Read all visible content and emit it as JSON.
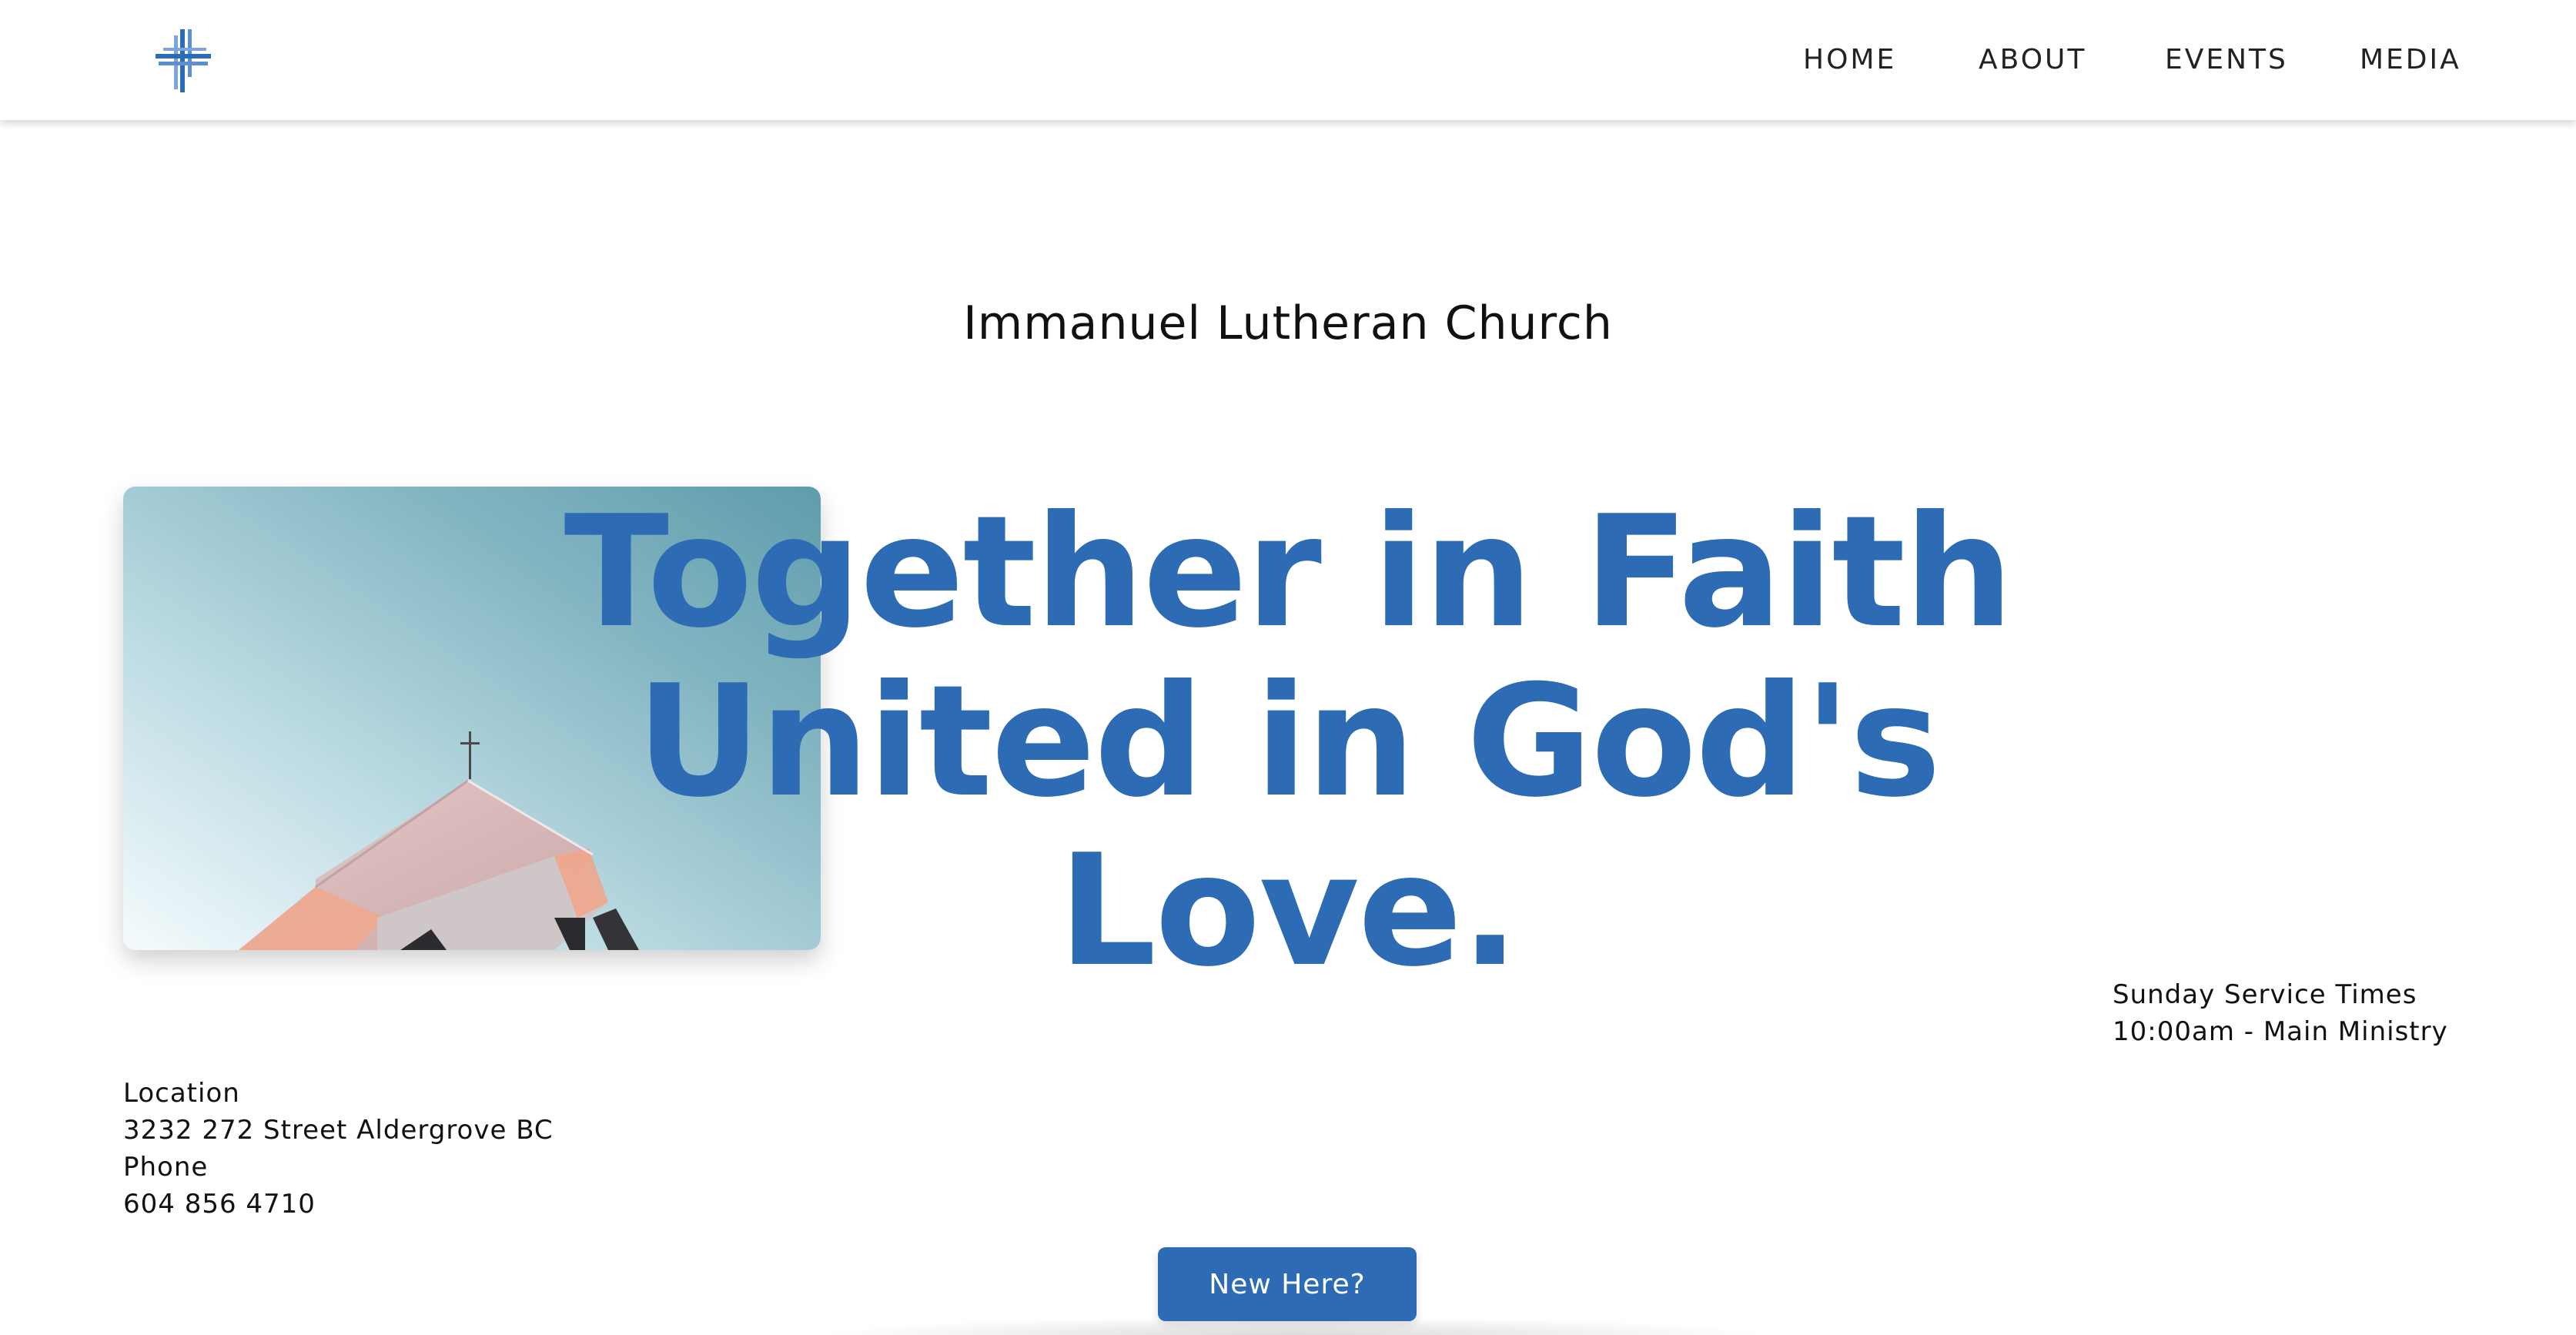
{
  "nav": {
    "logo_icon": "lutheran-cross-icon",
    "items": [
      {
        "label": "HOME"
      },
      {
        "label": "ABOUT"
      },
      {
        "label": "EVENTS"
      },
      {
        "label": "MEDIA"
      }
    ]
  },
  "hero": {
    "eyebrow": "Immanuel Lutheran Church",
    "headline_lines": [
      "Together in Faith",
      "United in God's",
      "Love."
    ],
    "image": "church-rooftop-photo",
    "cta_label": "New Here?"
  },
  "service": {
    "heading": "Sunday Service Times",
    "time": "10:00am - Main Ministry"
  },
  "contact": {
    "location_label": "Location",
    "address": "3232 272 Street Aldergrove BC",
    "phone_label": "Phone",
    "phone": "604 856 4710"
  },
  "colors": {
    "accent": "#2d6bb5",
    "text": "#111111",
    "background": "#ffffff"
  }
}
